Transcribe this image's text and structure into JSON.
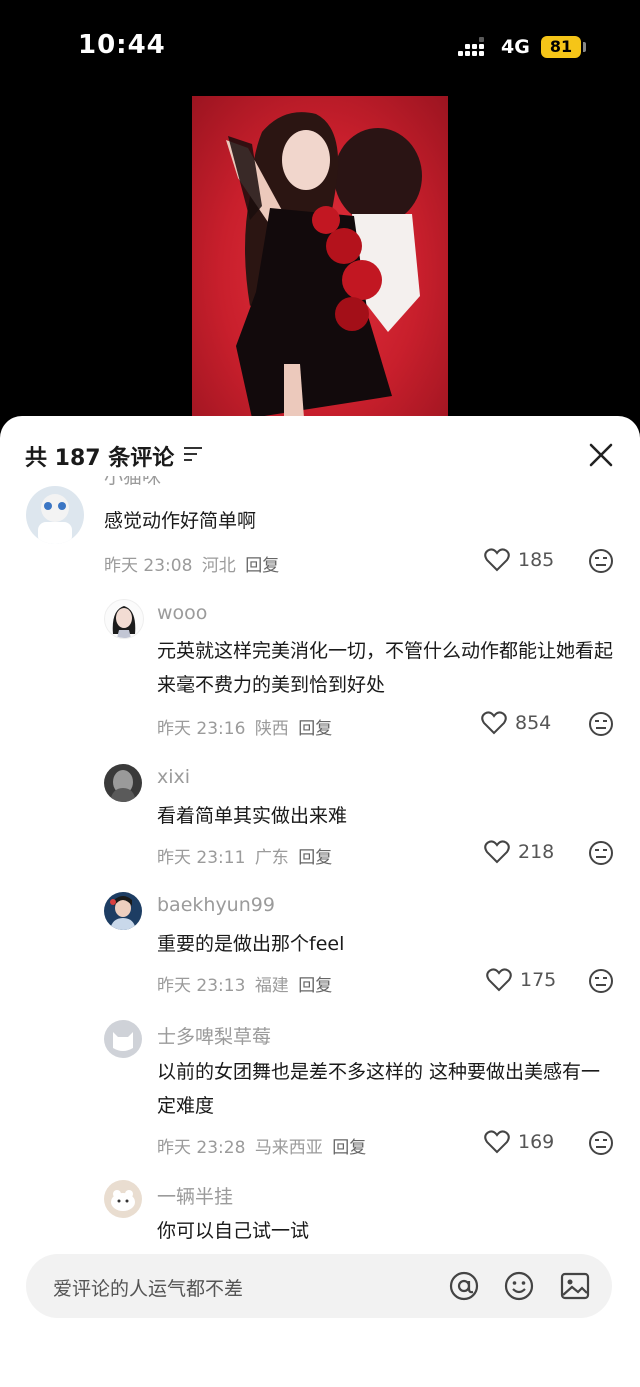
{
  "status_bar": {
    "time": "10:44",
    "network": "4G",
    "battery": "81"
  },
  "header": {
    "count_text": "共 187 条评论"
  },
  "comments": [
    {
      "name": "小猫咪",
      "text": "感觉动作好简单啊",
      "time": "昨天 23:08",
      "location": "河北",
      "reply": "回复",
      "likes": "185"
    },
    {
      "name": "wooo",
      "text": "元英就这样完美消化一切，不管什么动作都能让她看起来毫不费力的美到恰到好处",
      "time": "昨天 23:16",
      "location": "陕西",
      "reply": "回复",
      "likes": "854"
    },
    {
      "name": "xixi",
      "text": "看着简单其实做出来难",
      "time": "昨天 23:11",
      "location": "广东",
      "reply": "回复",
      "likes": "218"
    },
    {
      "name": "baekhyun99",
      "text": "重要的是做出那个feel",
      "time": "昨天 23:13",
      "location": "福建",
      "reply": "回复",
      "likes": "175"
    },
    {
      "name": "士多啤梨草莓",
      "text": "以前的女团舞也是差不多这样的 这种要做出美感有一定难度",
      "time": "昨天 23:28",
      "location": "马来西亚",
      "reply": "回复",
      "likes": "169"
    },
    {
      "name": "一辆半挂",
      "text": "你可以自己试一试"
    }
  ],
  "input": {
    "placeholder": "爱评论的人运气都不差"
  }
}
